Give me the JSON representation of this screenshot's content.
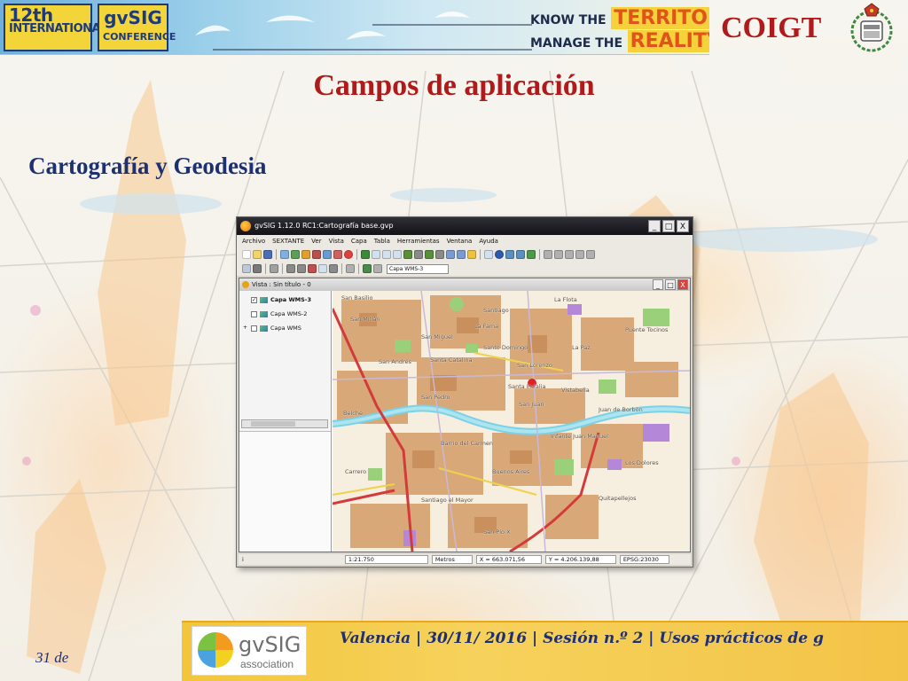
{
  "banner": {
    "badge_12_line1": "12th",
    "badge_12_line2": "INTERNATIONAL",
    "badge_gvsig_line1": "gvSIG",
    "badge_gvsig_line2": "CONFERENCE",
    "know_small": "KNOW THE",
    "know_big": "TERRITORY",
    "manage_small": "MANAGE THE",
    "manage_big": "REALITY"
  },
  "header": {
    "org": "COIGT"
  },
  "slide": {
    "title": "Campos de aplicación",
    "subtitle": "Cartografía y Geodesia"
  },
  "app_window": {
    "title": "gvSIG 1.12.0 RC1:Cartografía base.gvp",
    "window_buttons": [
      "_",
      "□",
      "X"
    ],
    "menu": [
      "Archivo",
      "SEXTANTE",
      "Ver",
      "Vista",
      "Capa",
      "Tabla",
      "Herramientas",
      "Ventana",
      "Ayuda"
    ],
    "layer_select": "Capa WMS-3",
    "view": {
      "title": "Vista : Sin título - 0",
      "buttons": [
        "_",
        "□",
        "X"
      ],
      "layers": [
        {
          "label": "Capa WMS-3",
          "checked": true,
          "selected": true
        },
        {
          "label": "Capa WMS-2",
          "checked": false,
          "selected": false
        },
        {
          "label": "Capa WMS",
          "checked": false,
          "selected": false
        }
      ],
      "map_labels": [
        "San Basilio",
        "San Millán",
        "La Flota",
        "Santiago",
        "La Fama",
        "San Miguel",
        "Santa Catalina",
        "San Andrés",
        "Santo Domingo",
        "San Lorenzo",
        "La Paz",
        "Puente Tocinos",
        "Santa Eulalia",
        "Vistabella",
        "San Juan",
        "San Pedro",
        "Belche",
        "Barrio del Carmen",
        "Infante Juan Manuel",
        "Buenos Aires",
        "Los Dolores",
        "Carrero",
        "Santiago el Mayor",
        "San Pío X",
        "Quitapellejos",
        "Juan de Borbón"
      ]
    },
    "status": {
      "info": "i",
      "scale": "1:21.750",
      "units": "Metros",
      "x": "X = 663.071,56",
      "y": "Y = 4.206.139,88",
      "crs": "EPSG:23030"
    }
  },
  "footer": {
    "logo_name": "gvSIG",
    "logo_sub": "association",
    "text": "Valencia | 30/11/ 2016 | Sesión n.º 2 | Usos prácticos de g",
    "page": "31 de"
  },
  "colors": {
    "title_red": "#b01a1a",
    "subtitle_blue": "#1d3170",
    "footer_yellow": "#f2c53b"
  }
}
